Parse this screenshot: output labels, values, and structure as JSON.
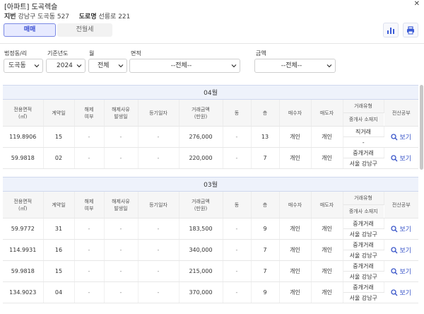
{
  "title": "[아파트] 도곡렉슬",
  "address": {
    "lot_label": "지번",
    "lot_value": "강남구 도곡동 527",
    "road_label": "도로명",
    "road_value": "선릉로 221"
  },
  "tabs": [
    "매매",
    "전월세"
  ],
  "filters": {
    "dong_label": "법정동/리",
    "dong_value": "도곡동",
    "year_label": "기준년도",
    "year_value": "2024",
    "month_label": "월",
    "month_value": "전체",
    "area_label": "면적",
    "area_value": "--전체--",
    "amount_label": "금액",
    "amount_value": "--전체--"
  },
  "table": {
    "headers": {
      "area": "전용면적",
      "area_unit": "(㎡)",
      "contract_day": "계약일",
      "cancel": "해제",
      "cancel2": "여부",
      "cancel_reason": "해제사유",
      "cancel_reason2": "발생일",
      "reg_date": "등기일자",
      "amount": "거래금액",
      "amount_unit": "(만원)",
      "building": "동",
      "floor": "층",
      "buyer": "매수자",
      "seller": "매도자",
      "deal_type": "거래유형",
      "broker_loc": "중개사 소재지",
      "ledger": "전산공부"
    },
    "view_label": "보기",
    "months": [
      {
        "label": "04월",
        "rows": [
          {
            "area": "119.8906",
            "day": "15",
            "cancel": "-",
            "reason": "-",
            "reg": "-",
            "amount": "276,000",
            "dong": "-",
            "floor": "13",
            "buyer": "개인",
            "seller": "개인",
            "type": "직거래",
            "loc": "-"
          },
          {
            "area": "59.9818",
            "day": "02",
            "cancel": "-",
            "reason": "-",
            "reg": "-",
            "amount": "220,000",
            "dong": "-",
            "floor": "7",
            "buyer": "개인",
            "seller": "개인",
            "type": "중개거래",
            "loc": "서울 강남구"
          }
        ]
      },
      {
        "label": "03월",
        "rows": [
          {
            "area": "59.9772",
            "day": "31",
            "cancel": "-",
            "reason": "-",
            "reg": "-",
            "amount": "183,500",
            "dong": "-",
            "floor": "9",
            "buyer": "개인",
            "seller": "개인",
            "type": "중개거래",
            "loc": "서울 강남구"
          },
          {
            "area": "114.9931",
            "day": "16",
            "cancel": "-",
            "reason": "-",
            "reg": "-",
            "amount": "340,000",
            "dong": "-",
            "floor": "7",
            "buyer": "개인",
            "seller": "개인",
            "type": "중개거래",
            "loc": "서울 강남구"
          },
          {
            "area": "59.9818",
            "day": "15",
            "cancel": "-",
            "reason": "-",
            "reg": "-",
            "amount": "215,000",
            "dong": "-",
            "floor": "7",
            "buyer": "개인",
            "seller": "개인",
            "type": "중개거래",
            "loc": "서울 강남구"
          },
          {
            "area": "134.9023",
            "day": "04",
            "cancel": "-",
            "reason": "-",
            "reg": "-",
            "amount": "370,000",
            "dong": "-",
            "floor": "9",
            "buyer": "개인",
            "seller": "개인",
            "type": "중개거래",
            "loc": "서울 강남구"
          }
        ]
      }
    ]
  },
  "colors": {
    "accent": "#3b4fd2",
    "tab_active_bg": "#e7eaff",
    "month_bg": "#eef2fb"
  },
  "icons": {
    "chart": "bar-chart-icon",
    "print": "printer-icon",
    "close": "close-icon",
    "view": "magnifier-icon"
  }
}
